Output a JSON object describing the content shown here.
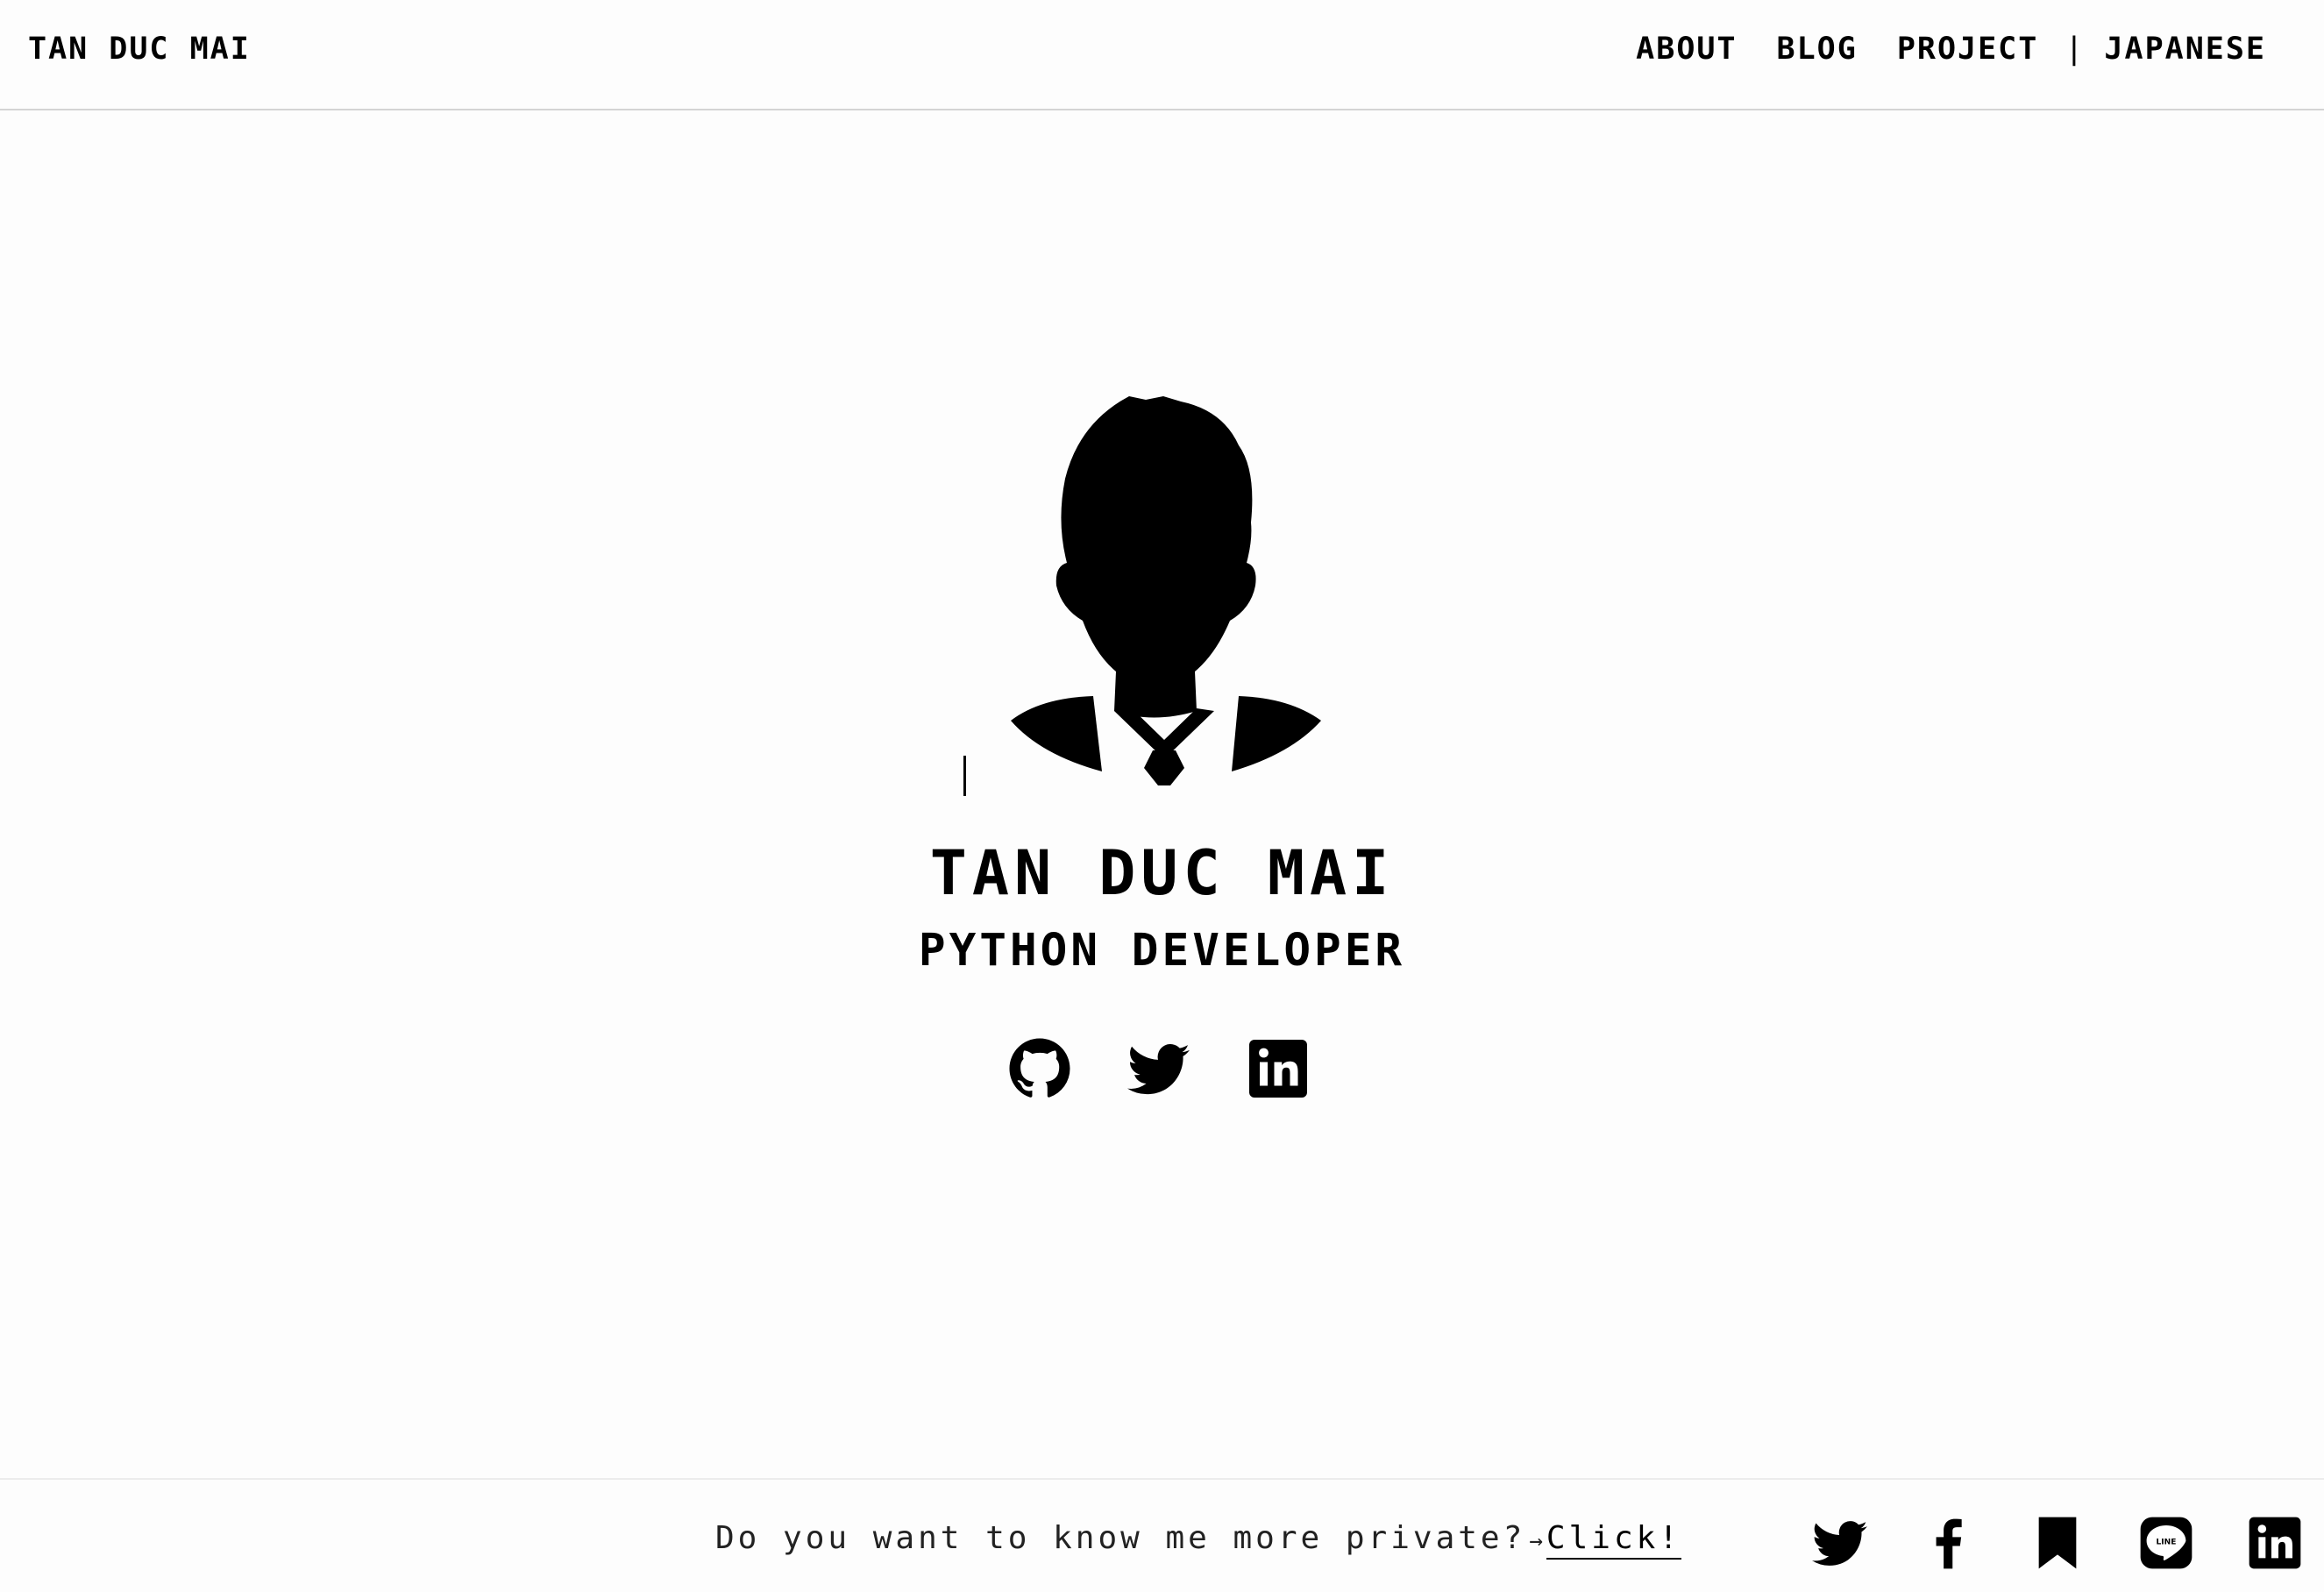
{
  "header": {
    "brand": "TAN DUC MAI",
    "nav": {
      "about": "ABOUT",
      "blog": "BLOG",
      "project": "PROJECT",
      "separator": "|",
      "language": "JAPANESE"
    }
  },
  "profile": {
    "avatar_icon": "person-silhouette-icon",
    "name": "TAN DUC MAI",
    "role": "PYTHON DEVELOPER",
    "links": [
      {
        "icon": "github-icon"
      },
      {
        "icon": "twitter-icon"
      },
      {
        "icon": "linkedin-icon"
      }
    ]
  },
  "footer": {
    "prompt": "Do you want to know me more private?",
    "arrow": "→",
    "cta": "Click!",
    "share": [
      {
        "icon": "twitter-icon"
      },
      {
        "icon": "facebook-icon"
      },
      {
        "icon": "bookmark-icon"
      },
      {
        "icon": "line-icon",
        "text": "LINE"
      },
      {
        "icon": "linkedin-icon"
      }
    ]
  },
  "colors": {
    "background": "#fdfdfd",
    "text": "#000000",
    "divider": "#d4d4d4"
  }
}
